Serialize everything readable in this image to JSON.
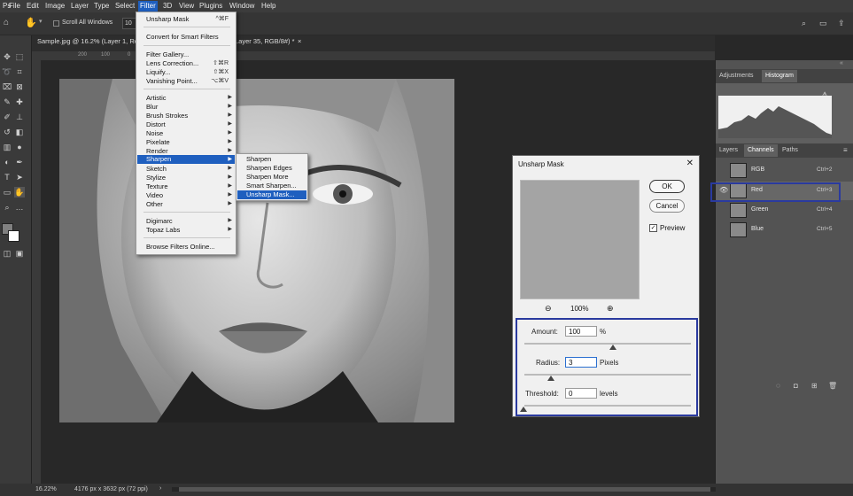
{
  "menubar": {
    "items": [
      "File",
      "Edit",
      "Image",
      "Layer",
      "Type",
      "Select",
      "Filter",
      "3D",
      "View",
      "Plugins",
      "Window",
      "Help"
    ],
    "active": "Filter"
  },
  "optionsbar": {
    "scroll_all_windows": "Scroll All Windows",
    "zoom_value": "10"
  },
  "document": {
    "tab1": "Sample.jpg @ 16.2% (Layer 1, Re",
    "tab2": "Layer 35, RGB/8#) *",
    "tab2_close": "×"
  },
  "ruler_ticks": [
    "200",
    "100",
    "0",
    "100",
    "200"
  ],
  "filter_menu": {
    "items": [
      {
        "label": "Unsharp Mask",
        "shortcut": "^⌘F"
      },
      {
        "label": "Convert for Smart Filters"
      },
      {
        "label": "Filter Gallery..."
      },
      {
        "label": "Lens Correction...",
        "shortcut": "⇧⌘R"
      },
      {
        "label": "Liquify...",
        "shortcut": "⇧⌘X"
      },
      {
        "label": "Vanishing Point...",
        "shortcut": "⌥⌘V"
      },
      {
        "label": "Artistic"
      },
      {
        "label": "Blur"
      },
      {
        "label": "Brush Strokes"
      },
      {
        "label": "Distort"
      },
      {
        "label": "Noise"
      },
      {
        "label": "Pixelate"
      },
      {
        "label": "Render"
      },
      {
        "label": "Sharpen"
      },
      {
        "label": "Sketch"
      },
      {
        "label": "Stylize"
      },
      {
        "label": "Texture"
      },
      {
        "label": "Video"
      },
      {
        "label": "Other"
      },
      {
        "label": "Digimarc"
      },
      {
        "label": "Topaz Labs"
      },
      {
        "label": "Browse Filters Online..."
      }
    ],
    "highlighted": "Sharpen"
  },
  "sharpen_submenu": {
    "items": [
      "Sharpen",
      "Sharpen Edges",
      "Sharpen More",
      "Smart Sharpen...",
      "Unsharp Mask..."
    ],
    "highlighted": "Unsharp Mask..."
  },
  "dialog": {
    "title": "Unsharp Mask",
    "ok": "OK",
    "cancel": "Cancel",
    "preview_label": "Preview",
    "preview_checked": true,
    "zoom": "100%",
    "amount_label": "Amount:",
    "amount_value": "100",
    "amount_unit": "%",
    "radius_label": "Radius:",
    "radius_value": "3",
    "radius_unit": "Pixels",
    "threshold_label": "Threshold:",
    "threshold_value": "0",
    "threshold_unit": "levels"
  },
  "right_panel": {
    "top_tabs": [
      "Adjustments",
      "Histogram"
    ],
    "active_top_tab": "Histogram",
    "channel_tabs": [
      "Layers",
      "Channels",
      "Paths"
    ],
    "active_channel_tab": "Channels",
    "channels": [
      {
        "name": "RGB",
        "shortcut": "Ctrl+2"
      },
      {
        "name": "Red",
        "shortcut": "Ctrl+3"
      },
      {
        "name": "Green",
        "shortcut": "Ctrl+4"
      },
      {
        "name": "Blue",
        "shortcut": "Ctrl+5"
      }
    ]
  },
  "status": {
    "zoom": "16.22%",
    "info": "4176 px x 3632 px (72 ppi)"
  },
  "colors": {
    "accent": "#1f5fbf",
    "highlight_border": "#2a3a9f"
  }
}
